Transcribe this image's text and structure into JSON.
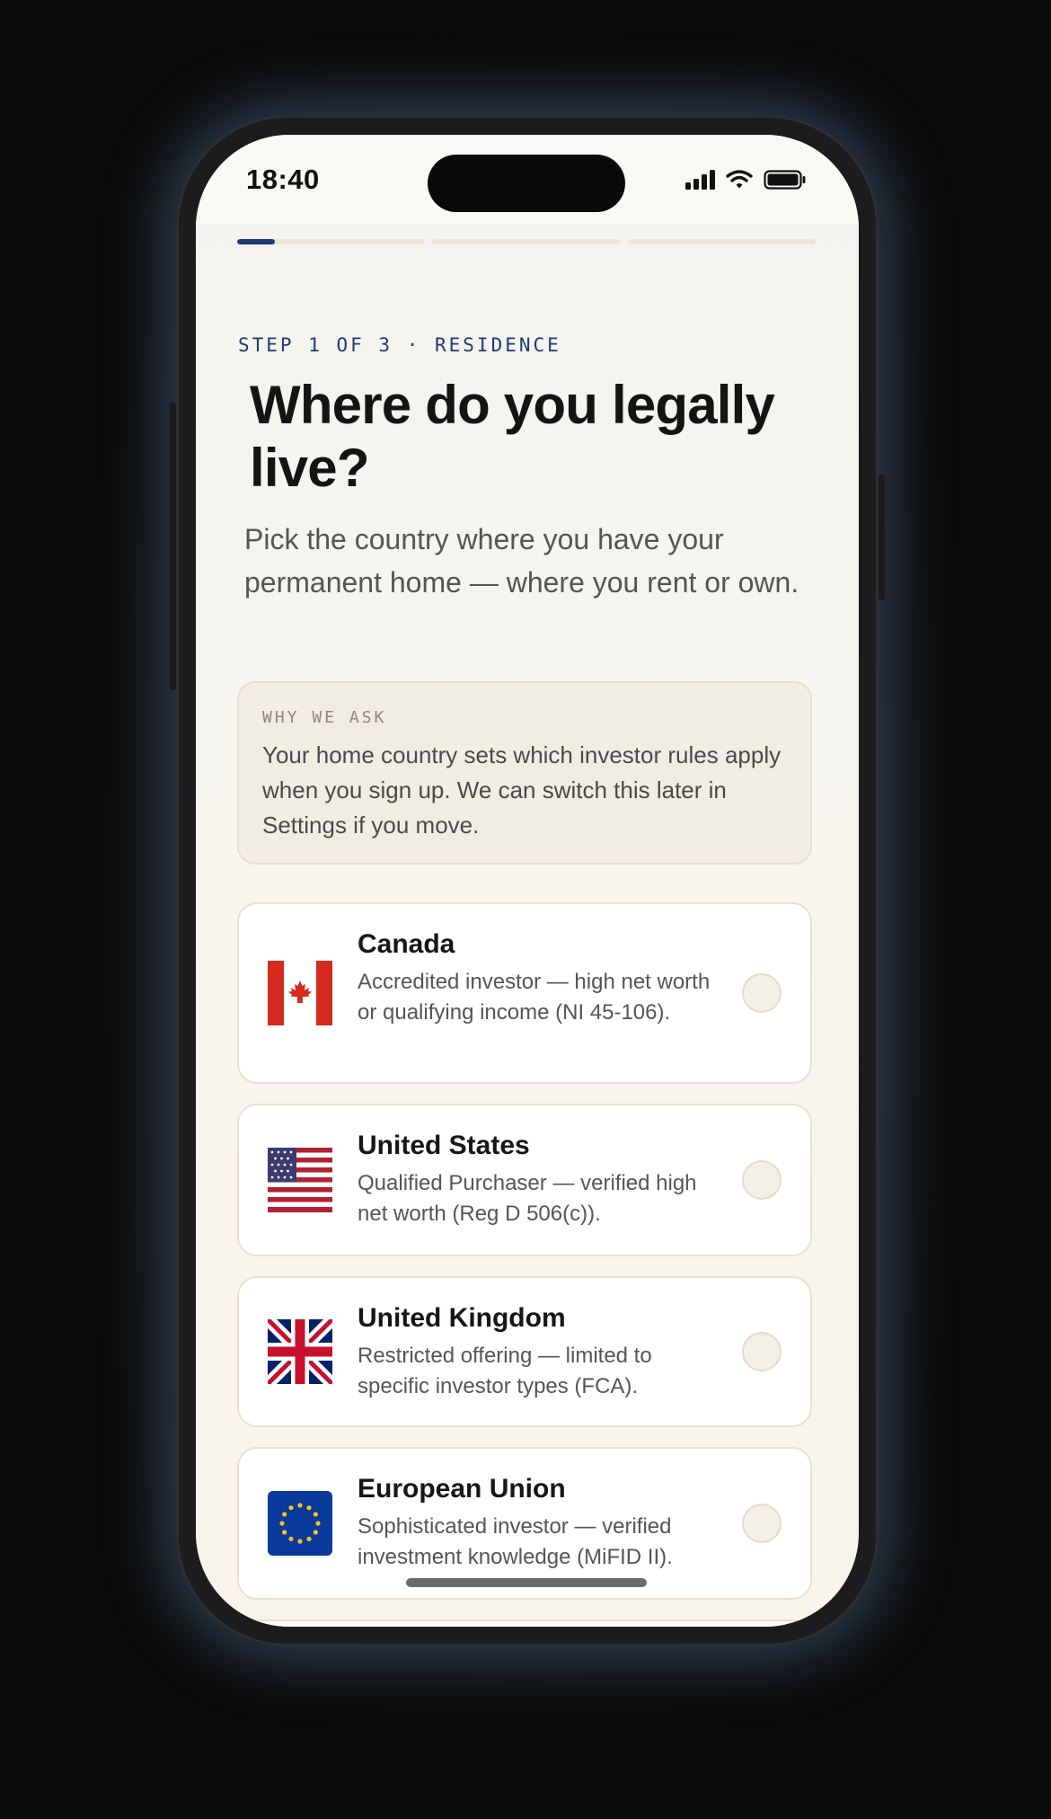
{
  "status": {
    "time": "18:40",
    "icons": [
      "cellular-signal-icon",
      "wifi-icon",
      "battery-icon"
    ]
  },
  "progress": {
    "steps": 3,
    "current_fill": 0.2
  },
  "header": {
    "eyebrow": "STEP 1 OF 3 · RESIDENCE",
    "title": "Where do you legally live?",
    "subtitle": "Pick the country where you have your permanent home — where you rent or own."
  },
  "why": {
    "label": "WHY WE ASK",
    "text": "Your home country sets which investor rules apply when you sign up. We can switch this later in Settings if you move."
  },
  "options": [
    {
      "name": "Canada",
      "desc": "Accredited investor — high net worth or qualifying income (NI 45-106).",
      "flag": "canada-flag-icon"
    },
    {
      "name": "United States",
      "desc": "Qualified Purchaser — verified high net worth (Reg D 506(c)).",
      "flag": "us-flag-icon"
    },
    {
      "name": "United Kingdom",
      "desc": "Restricted offering — limited to specific investor types (FCA).",
      "flag": "uk-flag-icon"
    },
    {
      "name": "European Union",
      "desc": "Sophisticated investor — verified investment knowledge (MiFID II).",
      "flag": "eu-flag-icon"
    }
  ],
  "colors": {
    "accent": "#1f3a73",
    "canada_red": "#d52b1e",
    "eu_blue": "#0a3a9c",
    "eu_star": "#f5c518"
  }
}
